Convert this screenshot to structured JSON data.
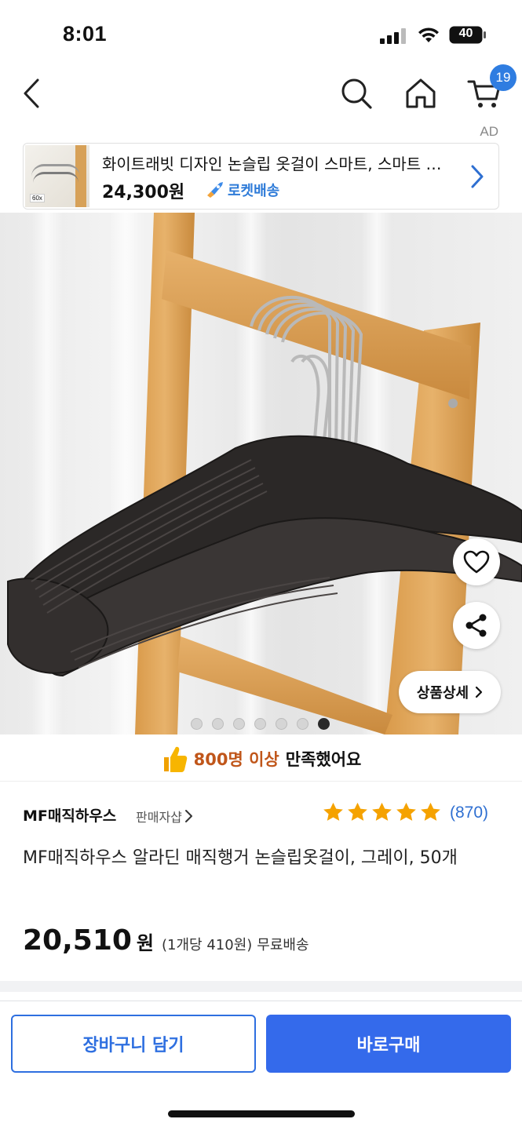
{
  "status_bar": {
    "time": "8:01",
    "battery": "40"
  },
  "nav": {
    "cart_count": "19",
    "icons": [
      "back-icon",
      "search-icon",
      "home-icon",
      "cart-icon"
    ]
  },
  "ad": {
    "label": "AD",
    "thumb_qty": "60x",
    "title": "화이트래빗 디자인 논슬립 옷걸이 스마트, 스마트 …",
    "price": "24,300원",
    "delivery": "로켓배송"
  },
  "gallery": {
    "detail_label": "상품상세",
    "total_images": 7,
    "active_index": 7
  },
  "satisfaction": {
    "count": "800명 이상",
    "suffix": "만족했어요"
  },
  "seller": {
    "name": "MF매직하우스",
    "shop_label": "판매자샵"
  },
  "rating": {
    "stars": 5,
    "count": "(870)"
  },
  "product": {
    "title": "MF매직하우스 알라딘 매직행거 논슬립옷걸이, 그레이, 50개",
    "price_num": "20,510",
    "price_won": "원",
    "unit_price": "(1개당 410원)",
    "shipping": "무료배송"
  },
  "actions": {
    "cart_button": "장바구니 담기",
    "buy_button": "바로구매"
  },
  "colors": {
    "accent_blue": "#346aeb",
    "badge_blue": "#2f7de1",
    "star_orange": "#f5a200",
    "highlight_orange": "#c0561a"
  }
}
